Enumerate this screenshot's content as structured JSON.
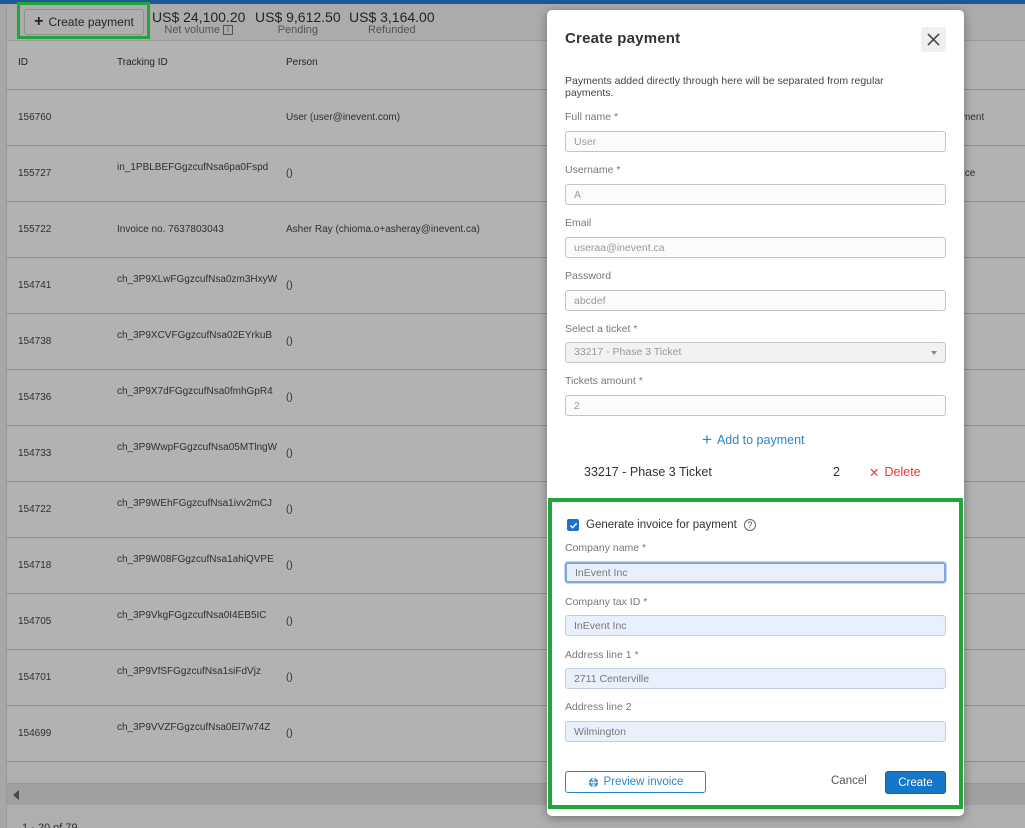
{
  "toolbar": {
    "create_payment_label": "Create payment",
    "stats": [
      {
        "amount": "US$ 24,100.20",
        "label": "Net volume"
      },
      {
        "amount": "US$ 9,612.50",
        "label": "Pending"
      },
      {
        "amount": "US$ 3,164.00",
        "label": "Refunded"
      }
    ]
  },
  "table": {
    "headers": {
      "id": "ID",
      "tracking_id": "Tracking ID",
      "person": "Person"
    },
    "rows": [
      {
        "id": "156760",
        "tracking_id": "",
        "person": "User (user@inevent.com)",
        "extra": "yment"
      },
      {
        "id": "155727",
        "tracking_id": "in_1PBLBEFGgzcufNsa6pa0Fspd",
        "person": "()",
        "extra": "oice"
      },
      {
        "id": "155722",
        "tracking_id": "Invoice no. 7637803043",
        "person": "Asher Ray (chioma.o+asheray@inevent.ca)",
        "extra": ""
      },
      {
        "id": "154741",
        "tracking_id": "ch_3P9XLwFGgzcufNsa0zm3HxyW",
        "person": "()",
        "extra": ""
      },
      {
        "id": "154738",
        "tracking_id": "ch_3P9XCVFGgzcufNsa02EYrkuB",
        "person": "()",
        "extra": ""
      },
      {
        "id": "154736",
        "tracking_id": "ch_3P9X7dFGgzcufNsa0fmhGpR4",
        "person": "()",
        "extra": ""
      },
      {
        "id": "154733",
        "tracking_id": "ch_3P9WwpFGgzcufNsa05MTlngW",
        "person": "()",
        "extra": ""
      },
      {
        "id": "154722",
        "tracking_id": "ch_3P9WEhFGgzcufNsa1ivv2mCJ",
        "person": "()",
        "extra": ""
      },
      {
        "id": "154718",
        "tracking_id": "ch_3P9W08FGgzcufNsa1ahiQVPE",
        "person": "()",
        "extra": ""
      },
      {
        "id": "154705",
        "tracking_id": "ch_3P9VkgFGgzcufNsa0I4EB5IC",
        "person": "()",
        "extra": ""
      },
      {
        "id": "154701",
        "tracking_id": "ch_3P9VfSFGgzcufNsa1siFdVjz",
        "person": "()",
        "extra": ""
      },
      {
        "id": "154699",
        "tracking_id": "ch_3P9VVZFGgzcufNsa0El7w74Z",
        "person": "()",
        "extra": ""
      }
    ],
    "pagination": "1 - 20 of 79"
  },
  "modal": {
    "title": "Create payment",
    "description": "Payments added directly through here will be separated from regular payments.",
    "fields": {
      "full_name": {
        "label": "Full name *",
        "value": "User"
      },
      "username": {
        "label": "Username *",
        "value": "A"
      },
      "email": {
        "label": "Email",
        "value": "useraa@inevent.ca"
      },
      "password": {
        "label": "Password",
        "value": "abcdef"
      },
      "ticket": {
        "label": "Select a ticket *",
        "value": "33217 - Phase 3 Ticket"
      },
      "tickets_amount": {
        "label": "Tickets amount *",
        "value": "2"
      }
    },
    "add_to_payment_label": "Add to payment",
    "ticket_item": {
      "name": "33217 - Phase 3 Ticket",
      "quantity": "2",
      "delete_label": "Delete"
    },
    "invoice": {
      "generate_label": "Generate invoice for payment",
      "generate_checked": true,
      "company_name": {
        "label": "Company name *",
        "value": "InEvent Inc"
      },
      "company_tax_id": {
        "label": "Company tax ID *",
        "value": "InEvent Inc"
      },
      "address_line_1": {
        "label": "Address line 1 *",
        "value": "2711 Centerville"
      },
      "address_line_2": {
        "label": "Address line 2",
        "value": "Wilmington"
      }
    },
    "buttons": {
      "preview_invoice": "Preview invoice",
      "cancel": "Cancel",
      "create": "Create"
    }
  },
  "colors": {
    "highlight": "#22a63a",
    "primary": "#1477c8",
    "link": "#2b86c6",
    "danger": "#e03a3a",
    "topbar": "#1d5a93"
  }
}
